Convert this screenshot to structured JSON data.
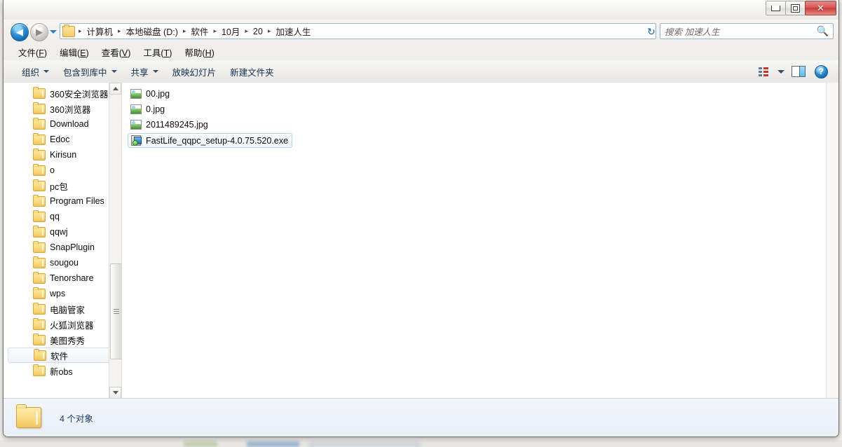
{
  "window": {
    "controls": {
      "minimize_label": "最小化",
      "maximize_label": "最大化",
      "close_label": "✕"
    }
  },
  "background": {
    "has_blurred_desktop": true,
    "orange_banner_color": "#efa300",
    "app_icon_color": "#2e86c8"
  },
  "nav": {
    "back_label": "◀",
    "back_tooltip": "后退",
    "forward_label": "▶",
    "forward_tooltip": "前进",
    "recent_locations_label": "最近访问的位置",
    "breadcrumb": [
      "计算机",
      "本地磁盘 (D:)",
      "软件",
      "10月",
      "20",
      "加速人生"
    ],
    "separator": "▸",
    "refresh_label": "↻",
    "dropdown_label": "▾"
  },
  "search": {
    "placeholder": "搜索 加速人生",
    "icon": "search-icon",
    "glyph": "🔍"
  },
  "menubar": {
    "items": [
      {
        "text": "文件",
        "accel": "F"
      },
      {
        "text": "编辑",
        "accel": "E"
      },
      {
        "text": "查看",
        "accel": "V"
      },
      {
        "text": "工具",
        "accel": "T"
      },
      {
        "text": "帮助",
        "accel": "H"
      }
    ]
  },
  "toolbar": {
    "items": [
      {
        "label": "组织",
        "has_dropdown": true
      },
      {
        "label": "包含到库中",
        "has_dropdown": true
      },
      {
        "label": "共享",
        "has_dropdown": true
      },
      {
        "label": "放映幻灯片",
        "has_dropdown": false
      },
      {
        "label": "新建文件夹",
        "has_dropdown": false
      }
    ],
    "right_icons": [
      {
        "name": "change-view-icon",
        "label": "更改您的视图"
      },
      {
        "name": "view-dropdown-icon",
        "label": "▾"
      },
      {
        "name": "preview-pane-icon",
        "label": "显示预览窗格"
      },
      {
        "name": "help-icon",
        "label": "?"
      }
    ]
  },
  "navpane": {
    "items": [
      {
        "label": "360安全浏览器",
        "selected": false
      },
      {
        "label": "360浏览器",
        "selected": false
      },
      {
        "label": "Download",
        "selected": false
      },
      {
        "label": "Edoc",
        "selected": false
      },
      {
        "label": "Kirisun",
        "selected": false
      },
      {
        "label": "o",
        "selected": false
      },
      {
        "label": "pc包",
        "selected": false
      },
      {
        "label": "Program Files",
        "selected": false
      },
      {
        "label": "qq",
        "selected": false
      },
      {
        "label": "qqwj",
        "selected": false
      },
      {
        "label": "SnapPlugin",
        "selected": false
      },
      {
        "label": "sougou",
        "selected": false
      },
      {
        "label": "Tenorshare",
        "selected": false
      },
      {
        "label": "wps",
        "selected": false
      },
      {
        "label": "电脑管家",
        "selected": false
      },
      {
        "label": "火狐浏览器",
        "selected": false
      },
      {
        "label": "美图秀秀",
        "selected": false
      },
      {
        "label": "软件",
        "selected": true
      },
      {
        "label": "新obs",
        "selected": false
      }
    ]
  },
  "filelist": {
    "files": [
      {
        "name": "00.jpg",
        "type": "jpg",
        "selected": false
      },
      {
        "name": "0.jpg",
        "type": "jpg",
        "selected": false
      },
      {
        "name": "2011489245.jpg",
        "type": "jpg",
        "selected": false
      },
      {
        "name": "FastLife_qqpc_setup-4.0.75.520.exe",
        "type": "exe",
        "selected": true
      }
    ]
  },
  "statusbar": {
    "item_count_text": "4 个对象"
  }
}
